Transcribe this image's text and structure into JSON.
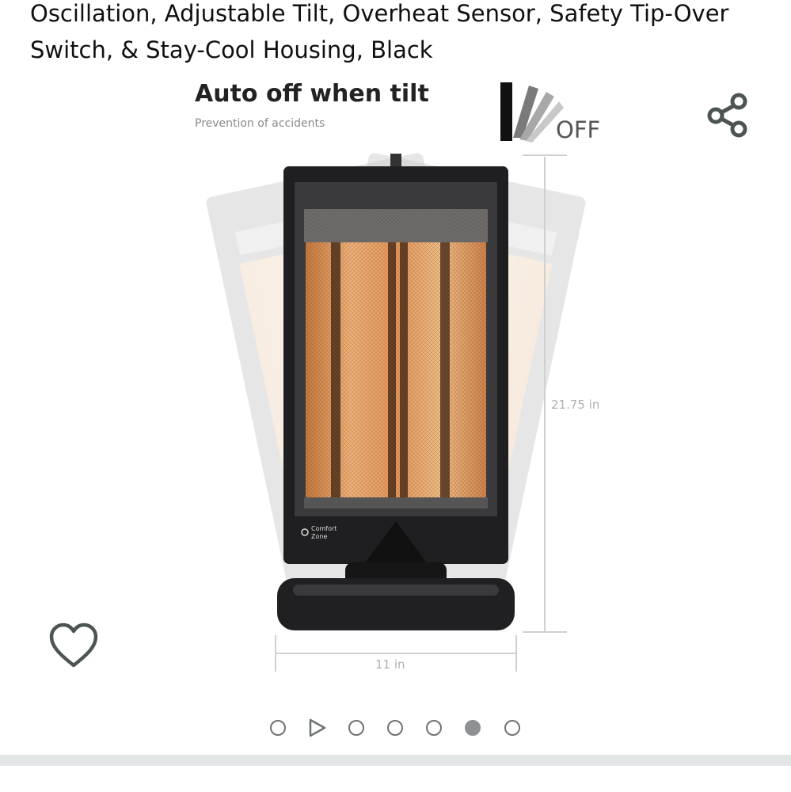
{
  "product": {
    "title": "Oscillation, Adjustable Tilt, Overheat Sensor, Safety Tip-Over Switch, & Stay-Cool Housing, Black"
  },
  "image": {
    "heading": "Auto off when tilt",
    "subheading": "Prevention of accidents",
    "off_label": "OFF",
    "height_label": "21.75 in",
    "width_label": "11 in",
    "brand_label_line1": "Comfort",
    "brand_label_line2": "Zone"
  },
  "actions": {
    "share_icon": "share-icon",
    "wishlist_icon": "heart-outline-icon"
  },
  "carousel": {
    "slides": [
      {
        "type": "image"
      },
      {
        "type": "video"
      },
      {
        "type": "image"
      },
      {
        "type": "image"
      },
      {
        "type": "image"
      },
      {
        "type": "image",
        "active": true
      },
      {
        "type": "image"
      }
    ],
    "active_index": 5
  },
  "colors": {
    "text": "#0f1111",
    "dot_border": "#6f7373",
    "dot_active": "#8d9191",
    "divider": "#e3e6e6",
    "heater_glow": "#e8a160",
    "heater_body": "#2a2a2c"
  }
}
